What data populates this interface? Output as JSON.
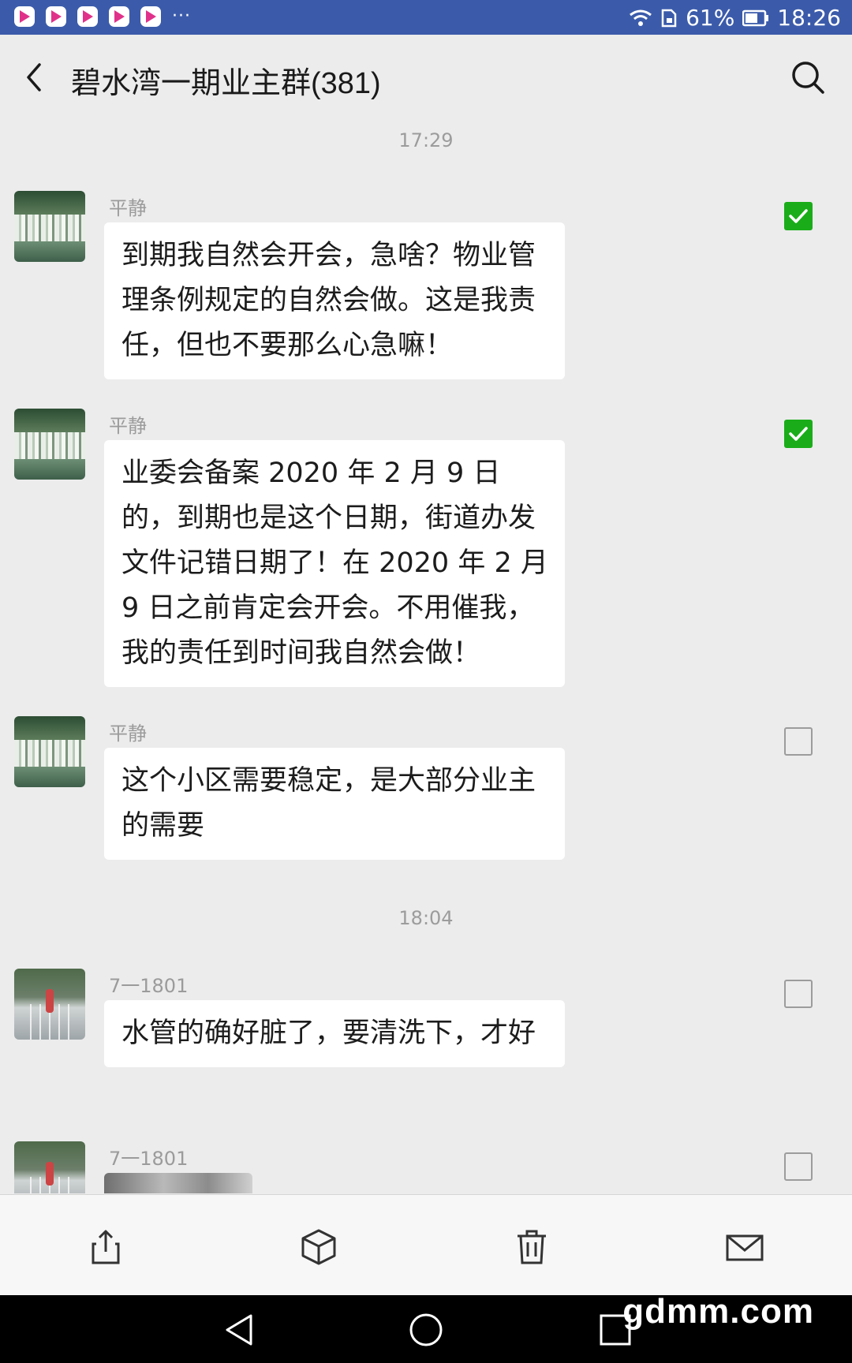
{
  "status_bar": {
    "app_icons": [
      "video-app-icon",
      "video-app-icon",
      "video-app-icon",
      "video-app-icon",
      "video-app-icon"
    ],
    "more_indicator": "···",
    "battery": "61%",
    "time": "18:26",
    "icons": [
      "wifi-icon",
      "sim-card-icon",
      "battery-icon"
    ]
  },
  "header": {
    "title": "碧水湾一期业主群(381)",
    "back_icon": "chevron-left-icon",
    "search_icon": "search-icon"
  },
  "time_separators": [
    "17:29",
    "18:04"
  ],
  "messages": [
    {
      "sender": "平静",
      "avatar": "waterfall-avatar",
      "text": "到期我自然会开会，急啥？物业管理条例规定的自然会做。这是我责任，但也不要那么心急嘛！",
      "selected": true
    },
    {
      "sender": "平静",
      "avatar": "waterfall-avatar",
      "text": "业委会备案 2020 年 2 月 9 日的，到期也是这个日期，街道办发文件记错日期了！在 2020 年 2 月 9 日之前肯定会开会。不用催我，我的责任到时间我自然会做！",
      "selected": true
    },
    {
      "sender": "平静",
      "avatar": "waterfall-avatar",
      "text": "这个小区需要稳定，是大部分业主的需要",
      "selected": false
    },
    {
      "sender": "7一1801",
      "avatar": "bridge-avatar",
      "text": "水管的确好脏了，要清洗下，才好",
      "selected": false
    },
    {
      "sender": "7一1801",
      "avatar": "bridge-avatar",
      "text": "",
      "is_image": true,
      "selected": false
    }
  ],
  "action_bar": [
    "share-icon",
    "favorite-box-icon",
    "delete-icon",
    "mail-icon"
  ],
  "nav_bar": [
    "back-triangle-icon",
    "home-circle-icon",
    "recents-square-icon"
  ],
  "watermark": "gdmm.com",
  "colors": {
    "status_bar": "#3b5baa",
    "background": "#ececec",
    "check_green": "#1aad19",
    "time_gray": "#9c9c9c"
  }
}
